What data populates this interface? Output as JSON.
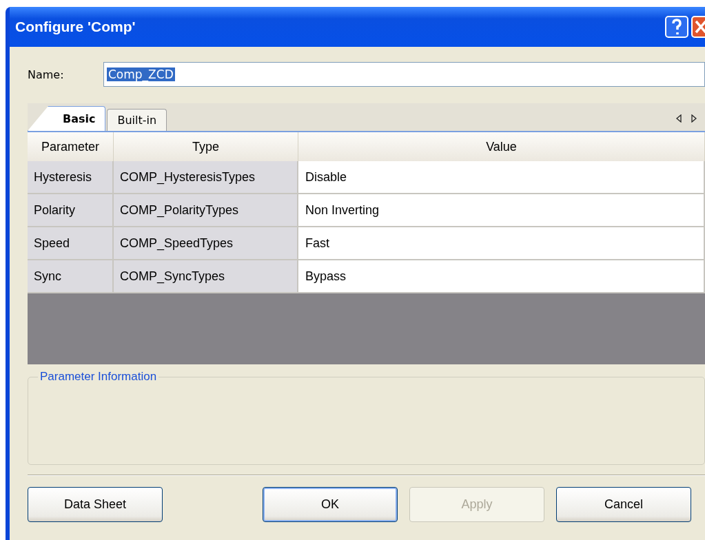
{
  "window": {
    "title": "Configure 'Comp'"
  },
  "name_field": {
    "label": "Name:",
    "value": "Comp_ZCD",
    "selected": true
  },
  "tabs": [
    {
      "label": "Basic",
      "selected": true
    },
    {
      "label": "Built-in",
      "selected": false
    }
  ],
  "table": {
    "columns": [
      "Parameter",
      "Type",
      "Value"
    ],
    "rows": [
      {
        "parameter": "Hysteresis",
        "type": "COMP_HysteresisTypes",
        "value": "Disable"
      },
      {
        "parameter": "Polarity",
        "type": "COMP_PolarityTypes",
        "value": "Non Inverting"
      },
      {
        "parameter": "Speed",
        "type": "COMP_SpeedTypes",
        "value": "Fast"
      },
      {
        "parameter": "Sync",
        "type": "COMP_SyncTypes",
        "value": "Bypass"
      }
    ]
  },
  "info_group": {
    "title": "Parameter Information"
  },
  "buttons": [
    {
      "label": "Data Sheet",
      "disabled": false,
      "default": false
    },
    {
      "label": "OK",
      "disabled": false,
      "default": true
    },
    {
      "label": "Apply",
      "disabled": true,
      "default": false
    },
    {
      "label": "Cancel",
      "disabled": false,
      "default": false
    }
  ]
}
